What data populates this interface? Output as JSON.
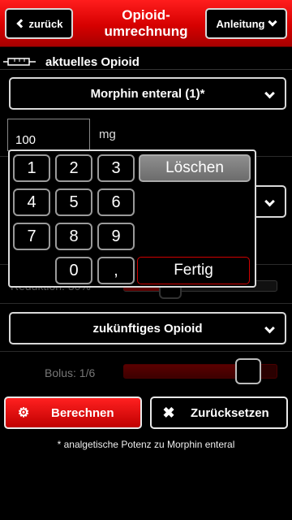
{
  "header": {
    "back_label": "zurück",
    "title_line1": "Opioid-",
    "title_line2": "umrechnung",
    "guide_label": "Anleitung"
  },
  "current_opioid": {
    "section_label": "aktuelles Opioid",
    "selected": "Morphin enteral (1)*",
    "dose_value": "100",
    "dose_unit": "mg"
  },
  "reduction": {
    "label": "Reduktion: 30%",
    "level_percent": 30
  },
  "future_opioid": {
    "selected": "zukünftiges Opioid"
  },
  "bolus": {
    "label": "Bolus: 1/6",
    "level_fraction": 0.8
  },
  "actions": {
    "calculate_label": "Berechnen",
    "reset_label": "Zurücksetzen"
  },
  "footnote": "* analgetische Potenz zu Morphin enteral",
  "keypad": {
    "keys": [
      "1",
      "2",
      "3",
      "4",
      "5",
      "6",
      "7",
      "8",
      "9",
      "0",
      ","
    ],
    "clear_label": "Löschen",
    "done_label": "Fertig"
  },
  "colors": {
    "accent": "#e00000",
    "background": "#000000"
  },
  "icons": {
    "back": "chevron-left-icon",
    "dropdown": "chevron-down-icon",
    "syringe": "syringe-icon",
    "calculate": "gear-icon",
    "reset": "close-icon"
  }
}
